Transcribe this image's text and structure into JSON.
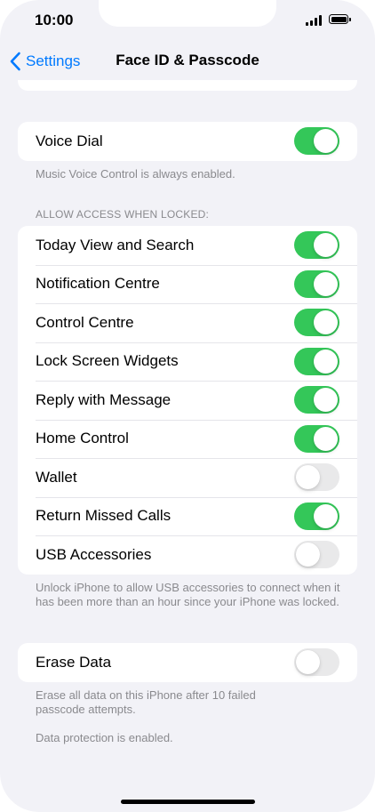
{
  "status_bar": {
    "time": "10:00"
  },
  "nav": {
    "back_label": "Settings",
    "title": "Face ID & Passcode"
  },
  "voice_dial": {
    "label": "Voice Dial",
    "on": true
  },
  "voice_dial_footer": "Music Voice Control is always enabled.",
  "locked_access": {
    "header": "ALLOW ACCESS WHEN LOCKED:",
    "items": [
      {
        "label": "Today View and Search",
        "on": true
      },
      {
        "label": "Notification Centre",
        "on": true
      },
      {
        "label": "Control Centre",
        "on": true
      },
      {
        "label": "Lock Screen Widgets",
        "on": true
      },
      {
        "label": "Reply with Message",
        "on": true
      },
      {
        "label": "Home Control",
        "on": true
      },
      {
        "label": "Wallet",
        "on": false
      },
      {
        "label": "Return Missed Calls",
        "on": true
      },
      {
        "label": "USB Accessories",
        "on": false
      }
    ],
    "footer": "Unlock iPhone to allow USB accessories to connect when it has been more than an hour since your iPhone was locked."
  },
  "erase_data": {
    "label": "Erase Data",
    "on": false
  },
  "erase_footer": "Erase all data on this iPhone after 10 failed passcode attempts.",
  "protection_footer": "Data protection is enabled.",
  "colors": {
    "accent": "#007aff",
    "toggle_on": "#34c759",
    "toggle_off": "#e9e9ea",
    "background": "#f2f2f7"
  }
}
